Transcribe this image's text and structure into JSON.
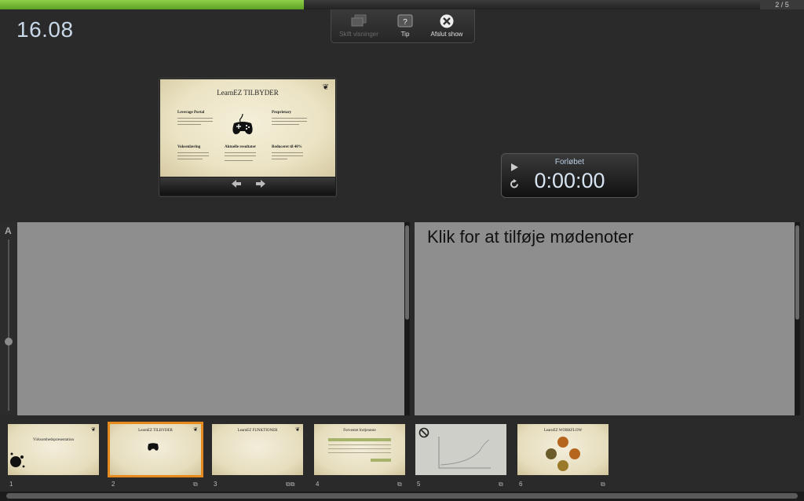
{
  "progress": {
    "fraction": 0.378,
    "counter": "2 / 5",
    "fill_color": "#6fb52e"
  },
  "clock": "16.08",
  "toolbar": {
    "items": [
      {
        "label": "Skift visninger",
        "icon": "displays-icon",
        "enabled": false
      },
      {
        "label": "Tip",
        "icon": "help-icon",
        "enabled": true
      },
      {
        "label": "Afslut show",
        "icon": "close-circle-icon",
        "enabled": true
      }
    ]
  },
  "current_slide": {
    "title": "LearnEZ TILBYDER",
    "sections": [
      "Leverage Portal",
      "Proprietary",
      "Voksenlæring",
      "Aktuelle resultater",
      "Reduceret til 40%"
    ],
    "nav": {
      "prev": "prev-arrow-icon",
      "next": "next-arrow-icon"
    }
  },
  "timer": {
    "label": "Forløbet",
    "value": "0:00:00"
  },
  "notes": {
    "placeholder": "Klik for at tilføje mødenoter"
  },
  "font_slider": {
    "label": "A"
  },
  "thumbnails": [
    {
      "num": "1",
      "title": "Virksomhedspræsentation",
      "selected": false,
      "dim": false
    },
    {
      "num": "2",
      "title": "LearnEZ TILBYDER",
      "selected": true,
      "dim": false
    },
    {
      "num": "3",
      "title": "LearnEZ FUNKTIONER",
      "selected": false,
      "dim": false
    },
    {
      "num": "4",
      "title": "Forventet fortjeneste",
      "selected": false,
      "dim": false
    },
    {
      "num": "5",
      "title": "",
      "selected": false,
      "dim": true
    },
    {
      "num": "6",
      "title": "LearnEZ WORKFLOW",
      "selected": false,
      "dim": false
    }
  ]
}
